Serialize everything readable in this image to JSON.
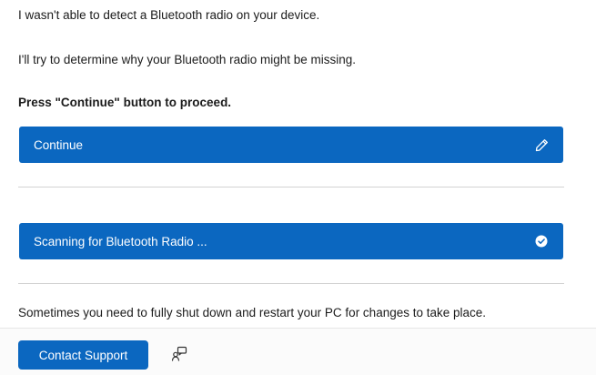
{
  "messages": {
    "line1": "I wasn't able to detect a Bluetooth radio on your device.",
    "line2": "I'll try to determine why your Bluetooth radio might be missing.",
    "instruction": "Press \"Continue\" button to proceed.",
    "restart_note": "Sometimes you need to fully shut down and restart your PC for changes to take place."
  },
  "actions": {
    "continue_label": "Continue",
    "continue_icon": "pencil-icon",
    "scanning_label": "Scanning for Bluetooth Radio ...",
    "scanning_icon": "check-circle-icon"
  },
  "footer": {
    "contact_support_label": "Contact Support",
    "feedback_icon": "share-feedback-icon"
  },
  "colors": {
    "accent": "#0b67c0",
    "divider": "#d2d2d2",
    "text": "#1b1b1b"
  }
}
